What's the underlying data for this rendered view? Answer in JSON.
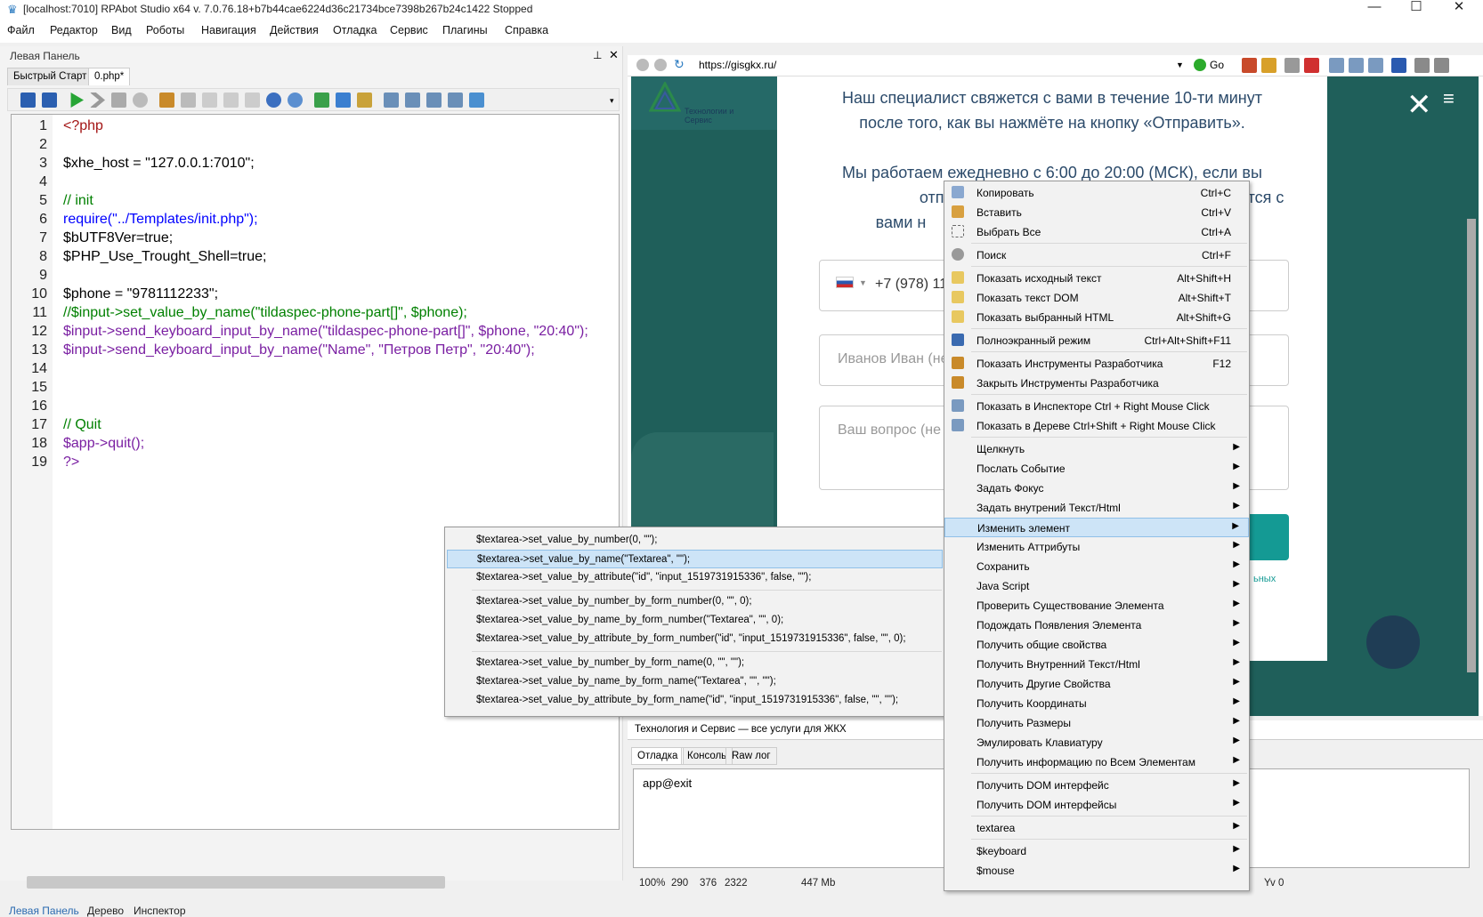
{
  "window": {
    "title": "[localhost:7010] RPAbot Studio x64 v. 7.0.76.18+b7b44cae6224d36c21734bce7398b267b24c1422 Stopped"
  },
  "menu": [
    "Файл",
    "Редактор",
    "Вид",
    "Роботы",
    "Навигация",
    "Действия",
    "Отладка",
    "Сервис",
    "Плагины",
    "Справка"
  ],
  "left_panel": {
    "title": "Левая Панель",
    "tabs": [
      "Быстрый Старт",
      "0.php*"
    ],
    "bottom_tabs": [
      "Левая Панель",
      "Дерево",
      "Инспектор"
    ]
  },
  "code_lines": [
    "<?php",
    "",
    "$xhe_host = \"127.0.0.1:7010\";",
    "",
    "// init",
    "require(\"../Templates/init.php\");",
    "$bUTF8Ver=true;",
    "$PHP_Use_Trought_Shell=true;",
    "",
    "$phone = \"9781112233\";",
    "//$input->set_value_by_name(\"tildaspec-phone-part[]\", $phone);",
    "$input->send_keyboard_input_by_name(\"tildaspec-phone-part[]\", $phone, \"20:40\");",
    "$input->send_keyboard_input_by_name(\"Name\", \"Петров Петр\", \"20:40\");",
    "",
    "",
    "",
    "// Quit",
    "$app->quit();",
    "?>"
  ],
  "browser": {
    "url": "https://gisgkx.ru/",
    "go_label": "Go",
    "logo_text": "Технологии и Сервис",
    "modal_lines": [
      "Наш специалист свяжется с вами в течение 10-ти минут",
      "после того, как вы нажмёте на кнопку «Отправить».",
      "",
      "Мы работаем ежедневно с 6:00 до 20:00 (МСК), если вы",
      "отправили заявк",
      "вами н"
    ],
    "right_fragments": [
      "тся с"
    ],
    "phone_value": "+7 (978) 11",
    "name_placeholder": "Иванов Иван (не",
    "question_placeholder": "Ваш вопрос (не",
    "tail_fragment": "ьных",
    "page_title": "Технология и Сервис — все услуги для ЖКХ"
  },
  "console": {
    "tabs": [
      "Отладка",
      "Консоль",
      "Raw лог"
    ],
    "output": "app@exit"
  },
  "context_menu": [
    {
      "label": "Копировать",
      "shortcut": "Ctrl+C"
    },
    {
      "label": "Вставить",
      "shortcut": "Ctrl+V"
    },
    {
      "label": "Выбрать Все",
      "shortcut": "Ctrl+A"
    },
    {
      "label": "Поиск",
      "shortcut": "Ctrl+F"
    },
    {
      "label": "Показать исходный текст",
      "shortcut": "Alt+Shift+H"
    },
    {
      "label": "Показать текст DOM",
      "shortcut": "Alt+Shift+T"
    },
    {
      "label": "Показать выбранный HTML",
      "shortcut": "Alt+Shift+G"
    },
    {
      "label": "Полноэкранный режим",
      "shortcut": "Ctrl+Alt+Shift+F11"
    },
    {
      "label": "Показать Инструменты Разработчика",
      "shortcut": "F12"
    },
    {
      "label": "Закрыть Инструменты Разработчика",
      "shortcut": ""
    },
    {
      "label": "Показать в Инспекторе Ctrl + Right Mouse Click",
      "shortcut": ""
    },
    {
      "label": "Показать в Дереве Ctrl+Shift + Right Mouse Click",
      "shortcut": ""
    },
    {
      "label": "Щелкнуть",
      "shortcut": ""
    },
    {
      "label": "Послать Событие",
      "shortcut": ""
    },
    {
      "label": "Задать Фокус",
      "shortcut": ""
    },
    {
      "label": "Задать внутрений Текст/Html",
      "shortcut": ""
    },
    {
      "label": "Изменить элемент",
      "shortcut": ""
    },
    {
      "label": "Изменить Аттрибуты",
      "shortcut": ""
    },
    {
      "label": "Сохранить",
      "shortcut": ""
    },
    {
      "label": "Java Script",
      "shortcut": ""
    },
    {
      "label": "Проверить Существование Элемента",
      "shortcut": ""
    },
    {
      "label": "Подождать Появления Элемента",
      "shortcut": ""
    },
    {
      "label": "Получить общие свойства",
      "shortcut": ""
    },
    {
      "label": "Получить Внутренний Текст/Html",
      "shortcut": ""
    },
    {
      "label": "Получить Другие Свойства",
      "shortcut": ""
    },
    {
      "label": "Получить Координаты",
      "shortcut": ""
    },
    {
      "label": "Получить Размеры",
      "shortcut": ""
    },
    {
      "label": "Эмулировать Клавиатуру",
      "shortcut": ""
    },
    {
      "label": "Получить информацию по Всем Элементам",
      "shortcut": ""
    },
    {
      "label": "Получить DOM интерфейс",
      "shortcut": ""
    },
    {
      "label": "Получить DOM интерфейсы",
      "shortcut": ""
    },
    {
      "label": "textarea",
      "shortcut": ""
    },
    {
      "label": "$keyboard",
      "shortcut": ""
    },
    {
      "label": "$mouse",
      "shortcut": ""
    }
  ],
  "submenu": [
    "$textarea->set_value_by_number(0, \"\");",
    "$textarea->set_value_by_name(\"Textarea\", \"\");",
    "$textarea->set_value_by_attribute(\"id\", \"input_1519731915336\", false, \"\");",
    "$textarea->set_value_by_number_by_form_number(0, \"\", 0);",
    "$textarea->set_value_by_name_by_form_number(\"Textarea\", \"\", 0);",
    "$textarea->set_value_by_attribute_by_form_number(\"id\", \"input_1519731915336\", false, \"\", 0);",
    "$textarea->set_value_by_number_by_form_name(0, \"\", \"\");",
    "$textarea->set_value_by_name_by_form_name(\"Textarea\", \"\", \"\");",
    "$textarea->set_value_by_attribute_by_form_name(\"id\", \"input_1519731915336\", false, \"\", \"\");"
  ],
  "status": [
    "100%",
    "290",
    "376",
    "2322",
    "447 Mb",
    "Yv 0"
  ]
}
